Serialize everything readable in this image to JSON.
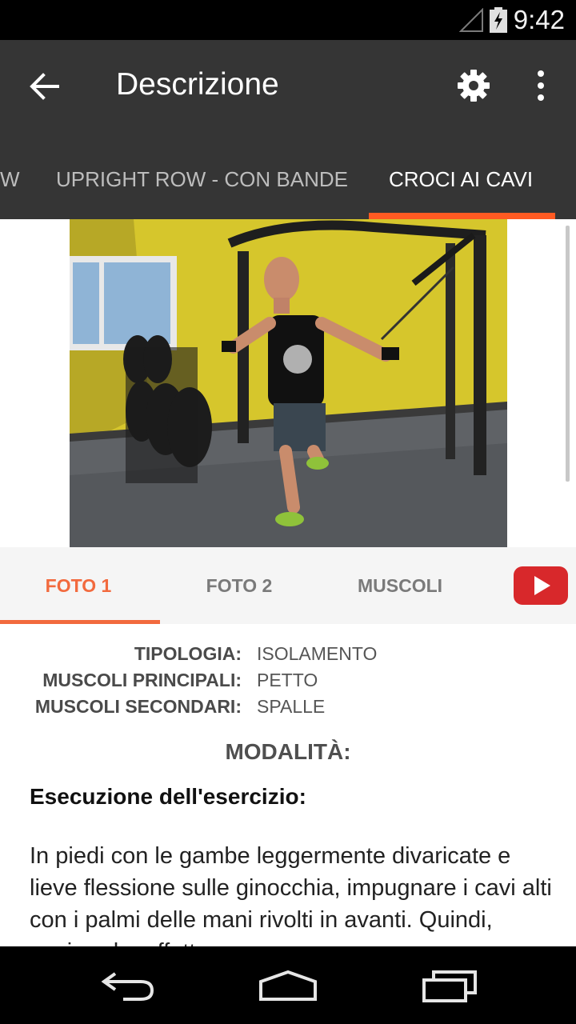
{
  "status_bar": {
    "time": "9:42"
  },
  "app_bar": {
    "title": "Descrizione"
  },
  "top_tabs": [
    {
      "label": "W"
    },
    {
      "label": "UPRIGHT ROW - CON BANDE"
    },
    {
      "label": "CROCI AI CAVI"
    }
  ],
  "sub_tabs": [
    {
      "label": "FOTO 1"
    },
    {
      "label": "FOTO 2"
    },
    {
      "label": "MUSCOLI"
    }
  ],
  "details": {
    "tipologia_label": "TIPOLOGIA:",
    "tipologia_value": "ISOLAMENTO",
    "principali_label": "MUSCOLI PRINCIPALI:",
    "principali_value": "PETTO",
    "secondari_label": "MUSCOLI SECONDARI:",
    "secondari_value": "SPALLE"
  },
  "modalita": "MODALITÀ:",
  "execution": {
    "title": "Esecuzione dell'esercizio:",
    "text": "In piedi con le gambe leggermente divaricate e lieve flessione sulle ginocchia, impugnare i cavi alti con i palmi delle mani rivolti in avanti. Quindi, espirando, effettuare"
  },
  "colors": {
    "accent": "#ff5a22",
    "app_bar": "#353535",
    "youtube_red": "#d8282b"
  },
  "icons": [
    "signal-icon",
    "battery-charging-icon",
    "back-arrow-icon",
    "gear-icon",
    "more-vert-icon",
    "youtube-play-icon",
    "nav-back-icon",
    "nav-home-icon",
    "nav-recents-icon"
  ]
}
